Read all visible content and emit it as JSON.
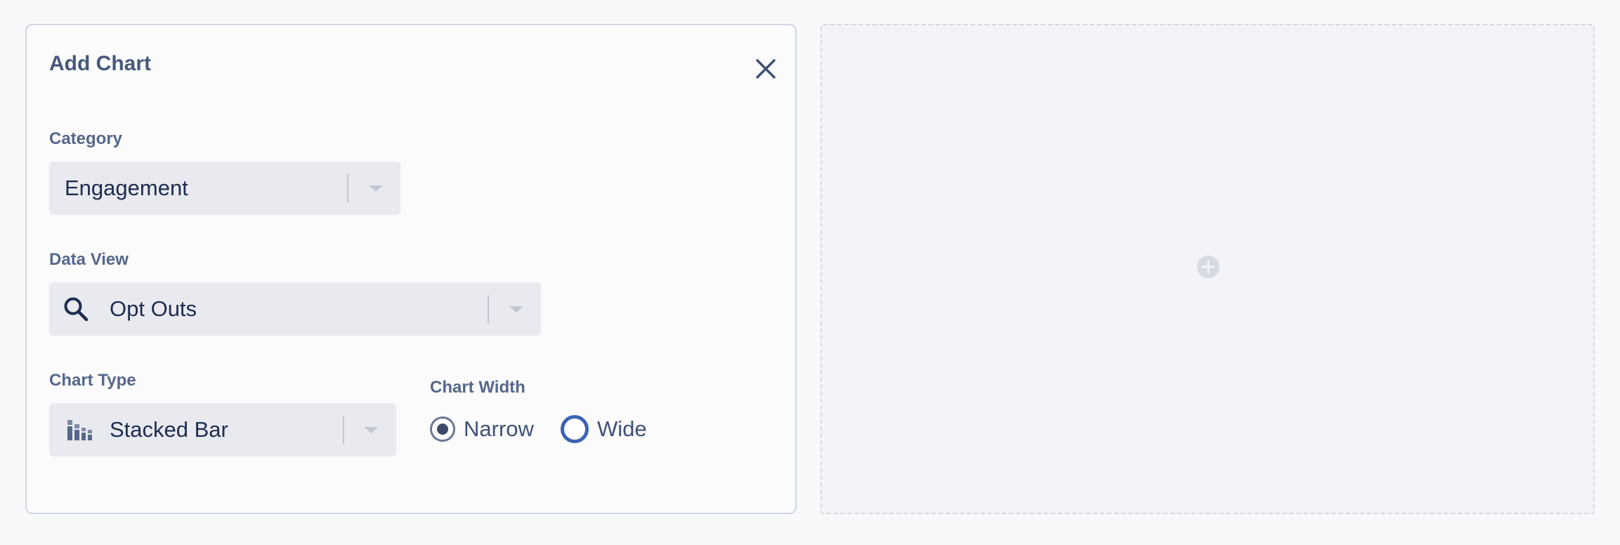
{
  "panel": {
    "title": "Add Chart"
  },
  "category": {
    "label": "Category",
    "value": "Engagement"
  },
  "data_view": {
    "label": "Data View",
    "value": "Opt Outs",
    "icon": "search-icon"
  },
  "chart_type": {
    "label": "Chart Type",
    "value": "Stacked Bar",
    "icon": "stacked-bar-chart-icon"
  },
  "chart_width": {
    "label": "Chart Width",
    "options": [
      {
        "label": "Narrow",
        "selected": true
      },
      {
        "label": "Wide",
        "selected": false
      }
    ]
  },
  "colors": {
    "title_text": "#46587a",
    "label_text": "#55678a",
    "value_text": "#1d2c4f",
    "select_bg": "#e8eaef",
    "radio_selected": "#3c4a6a",
    "radio_focus": "#3b63b5",
    "panel_border": "#cfd6e4",
    "dropzone_bg": "#f3f4f8"
  }
}
